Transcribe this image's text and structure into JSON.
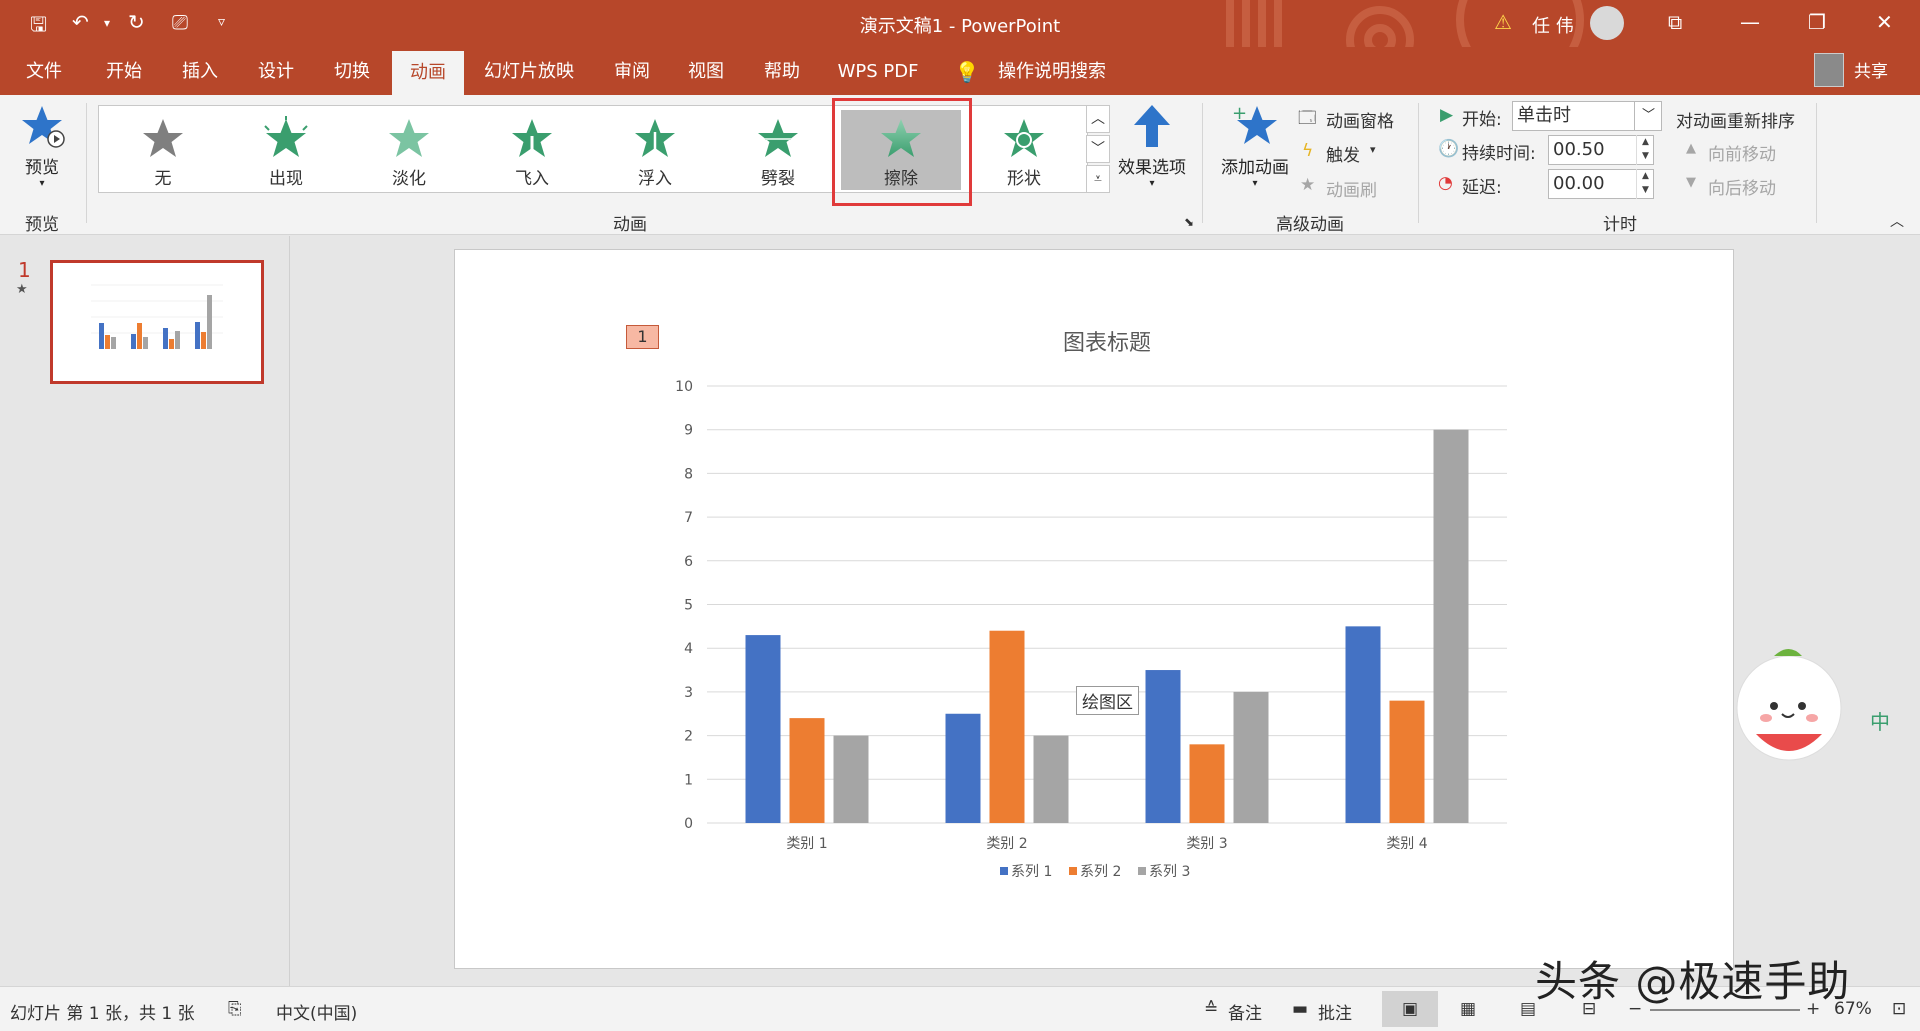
{
  "window": {
    "title": "演示文稿1  -  PowerPoint",
    "user": "任 伟",
    "share": "共享"
  },
  "menu": {
    "tabs": [
      "文件",
      "开始",
      "插入",
      "设计",
      "切换",
      "动画",
      "幻灯片放映",
      "审阅",
      "视图",
      "帮助",
      "WPS PDF"
    ],
    "active": "动画",
    "search": "操作说明搜索"
  },
  "ribbon": {
    "preview": {
      "button": "预览",
      "group": "预览"
    },
    "animations": {
      "items": [
        "无",
        "出现",
        "淡化",
        "飞入",
        "浮入",
        "劈裂",
        "擦除",
        "形状"
      ],
      "selected": "擦除",
      "effect_options": "效果选项",
      "group": "动画"
    },
    "advanced": {
      "add_animation": "添加动画",
      "animation_pane": "动画窗格",
      "trigger": "触发",
      "painter": "动画刷",
      "group": "高级动画"
    },
    "timing": {
      "start_label": "开始:",
      "start_value": "单击时",
      "duration_label": "持续时间:",
      "duration_value": "00.50",
      "delay_label": "延迟:",
      "delay_value": "00.00",
      "reorder": "对动画重新排序",
      "move_earlier": "向前移动",
      "move_later": "向后移动",
      "group": "计时"
    }
  },
  "thumbs": {
    "slide_number": "1"
  },
  "slide": {
    "animation_tag": "1",
    "tooltip": "绘图区"
  },
  "chart_data": {
    "type": "bar",
    "title": "图表标题",
    "categories": [
      "类别 1",
      "类别 2",
      "类别 3",
      "类别 4"
    ],
    "series": [
      {
        "name": "系列 1",
        "values": [
          4.3,
          2.5,
          3.5,
          4.5
        ],
        "color": "#4472c4"
      },
      {
        "name": "系列 2",
        "values": [
          2.4,
          4.4,
          1.8,
          2.8
        ],
        "color": "#ed7d31"
      },
      {
        "name": "系列 3",
        "values": [
          2,
          2,
          3,
          9
        ],
        "color": "#a5a5a5"
      }
    ],
    "ylim": [
      0,
      10
    ],
    "yticks": [
      "0",
      "1",
      "2",
      "3",
      "4",
      "5",
      "6",
      "7",
      "8",
      "9",
      "10"
    ],
    "grid": true,
    "legend": "bottom"
  },
  "status": {
    "slide_info": "幻灯片 第 1 张，共 1 张",
    "language": "中文(中国)",
    "notes": "备注",
    "comments": "批注",
    "zoom": "67%"
  },
  "watermark": "头条 @极速手助",
  "colors": {
    "accent": "#b7472a",
    "selected_border": "#e03a3a"
  }
}
